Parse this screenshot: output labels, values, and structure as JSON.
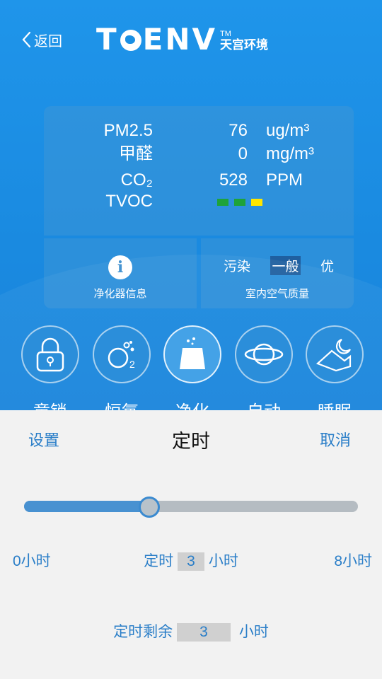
{
  "header": {
    "back_label": "返回",
    "brand_name": "TOENV",
    "brand_tm": "TM",
    "brand_cn": "天宫环境"
  },
  "metrics": [
    {
      "label": "PM2.5",
      "value": "76",
      "unit": "ug/m³"
    },
    {
      "label": "甲醛",
      "value": "0",
      "unit": "mg/m³"
    },
    {
      "label": "CO₂",
      "value": "528",
      "unit": "PPM"
    },
    {
      "label": "TVOC",
      "value": "",
      "unit": ""
    }
  ],
  "tvoc_indicator": {
    "colors": [
      "#1ea33a",
      "#1ea33a",
      "#ffe600"
    ]
  },
  "purifier_info": {
    "icon": "info-icon",
    "label": "净化器信息"
  },
  "air_quality": {
    "levels": [
      "污染",
      "一般",
      "优"
    ],
    "selected": "一般",
    "label": "室内空气质量"
  },
  "modes": [
    {
      "label": "童锁",
      "icon": "lock-icon"
    },
    {
      "label": "恒氧",
      "icon": "oxygen-icon"
    },
    {
      "label": "净化",
      "icon": "purify-icon"
    },
    {
      "label": "自动",
      "icon": "planet-icon"
    },
    {
      "label": "睡眠",
      "icon": "moon-icon"
    }
  ],
  "timer_sheet": {
    "settings_label": "设置",
    "title": "定时",
    "cancel_label": "取消",
    "slider_min_label": "0小时",
    "slider_max_label": "8小时",
    "slider_value": 3,
    "slider_max": 8,
    "timer_prefix": "定时",
    "timer_value": "3",
    "timer_unit": "小时",
    "remaining_prefix": "定时剩余",
    "remaining_value": "3",
    "remaining_unit": "小时"
  },
  "colors": {
    "background_blue": "#1a8fe3",
    "accent_blue": "#2a7ec8",
    "sheet_bg": "#f2f2f2"
  }
}
